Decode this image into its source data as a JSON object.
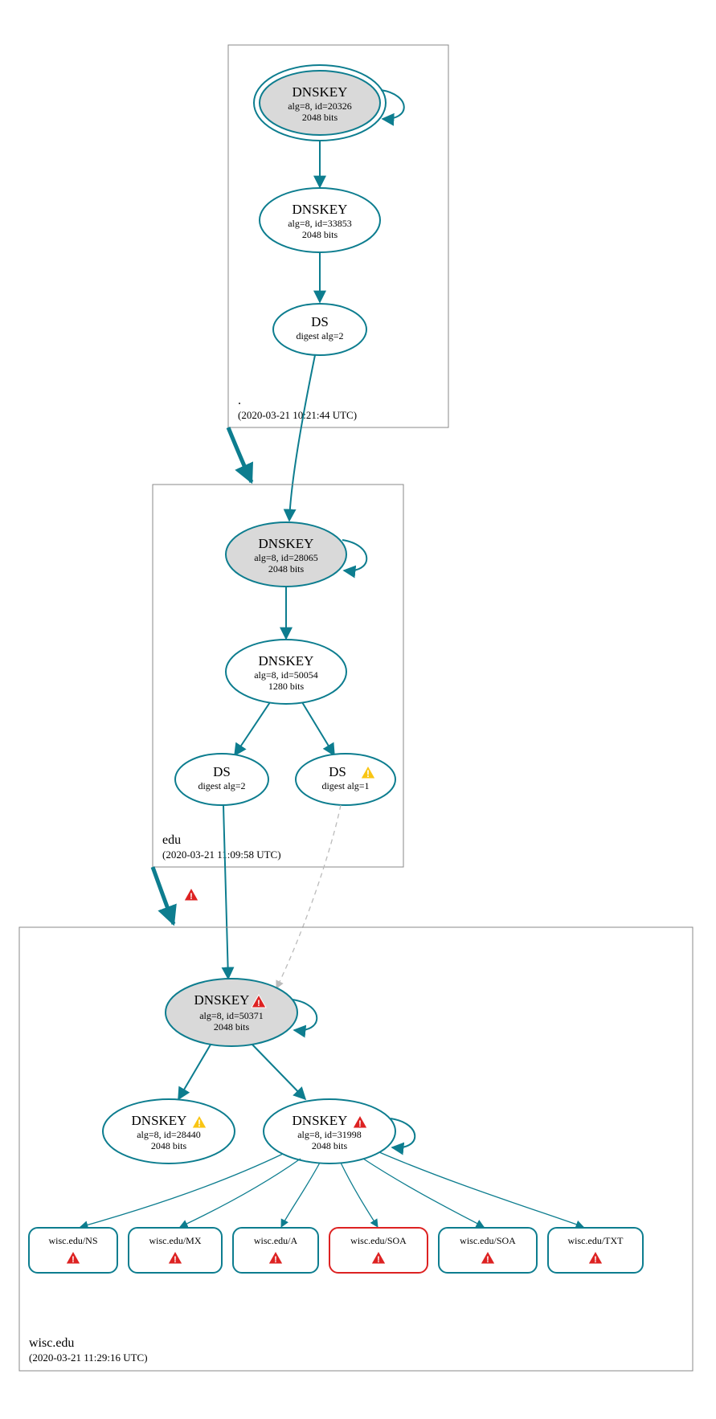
{
  "colors": {
    "accent": "#0d7d8f",
    "error": "#d22",
    "warn": "#f9c513",
    "node_fill_grey": "#d9d9d9"
  },
  "zones": {
    "root": {
      "label": ".",
      "timestamp": "(2020-03-21 10:21:44 UTC)"
    },
    "edu": {
      "label": "edu",
      "timestamp": "(2020-03-21 11:09:58 UTC)"
    },
    "wisc": {
      "label": "wisc.edu",
      "timestamp": "(2020-03-21 11:29:16 UTC)"
    }
  },
  "nodes": {
    "root_ksk": {
      "title": "DNSKEY",
      "line1": "alg=8, id=20326",
      "line2": "2048 bits"
    },
    "root_zsk": {
      "title": "DNSKEY",
      "line1": "alg=8, id=33853",
      "line2": "2048 bits"
    },
    "root_ds": {
      "title": "DS",
      "line1": "digest alg=2"
    },
    "edu_ksk": {
      "title": "DNSKEY",
      "line1": "alg=8, id=28065",
      "line2": "2048 bits"
    },
    "edu_zsk": {
      "title": "DNSKEY",
      "line1": "alg=8, id=50054",
      "line2": "1280 bits"
    },
    "edu_ds2": {
      "title": "DS",
      "line1": "digest alg=2"
    },
    "edu_ds1": {
      "title": "DS",
      "line1": "digest alg=1"
    },
    "wisc_ksk": {
      "title": "DNSKEY",
      "line1": "alg=8, id=50371",
      "line2": "2048 bits"
    },
    "wisc_zskA": {
      "title": "DNSKEY",
      "line1": "alg=8, id=28440",
      "line2": "2048 bits"
    },
    "wisc_zskB": {
      "title": "DNSKEY",
      "line1": "alg=8, id=31998",
      "line2": "2048 bits"
    }
  },
  "rrsets": {
    "ns": {
      "label": "wisc.edu/NS"
    },
    "mx": {
      "label": "wisc.edu/MX"
    },
    "a": {
      "label": "wisc.edu/A"
    },
    "soa1": {
      "label": "wisc.edu/SOA"
    },
    "soa2": {
      "label": "wisc.edu/SOA"
    },
    "txt": {
      "label": "wisc.edu/TXT"
    }
  }
}
